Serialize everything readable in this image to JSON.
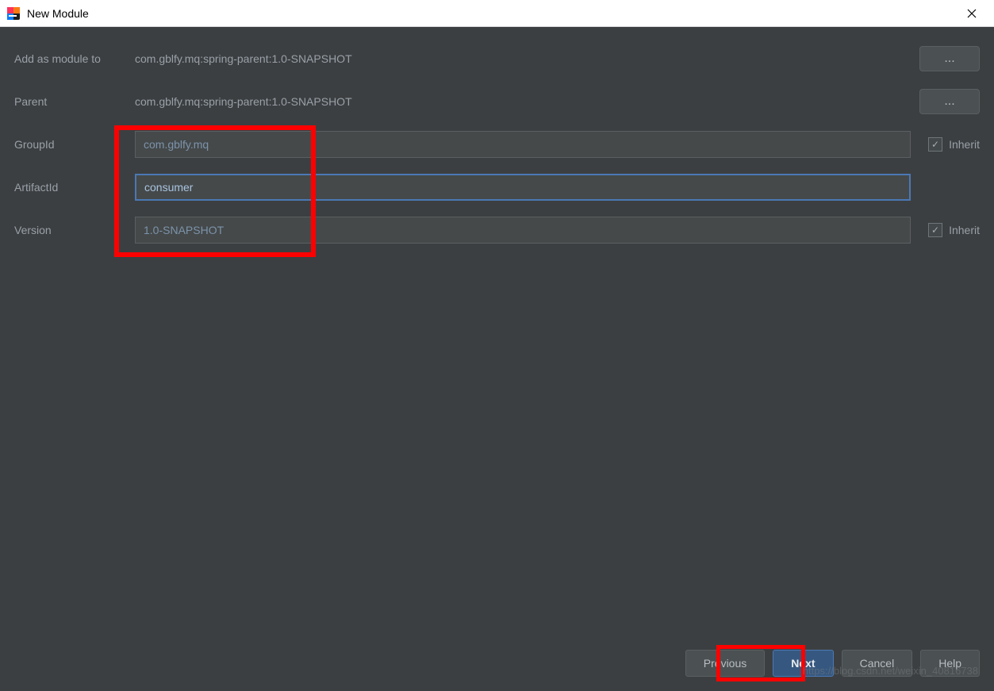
{
  "titlebar": {
    "title": "New Module"
  },
  "rows": {
    "addAsModule": {
      "label": "Add as module to",
      "value": "com.gblfy.mq:spring-parent:1.0-SNAPSHOT",
      "ellipsis": "..."
    },
    "parent": {
      "label": "Parent",
      "value": "com.gblfy.mq:spring-parent:1.0-SNAPSHOT",
      "ellipsis": "..."
    },
    "groupId": {
      "label": "GroupId",
      "value": "com.gblfy.mq",
      "inherit": "Inherit"
    },
    "artifactId": {
      "label": "ArtifactId",
      "value": "consumer"
    },
    "version": {
      "label": "Version",
      "value": "1.0-SNAPSHOT",
      "inherit": "Inherit"
    }
  },
  "footer": {
    "previous": "Previous",
    "next": "Next",
    "cancel": "Cancel",
    "help": "Help"
  },
  "watermark": "https://blog.csdn.net/weixin_40816738"
}
